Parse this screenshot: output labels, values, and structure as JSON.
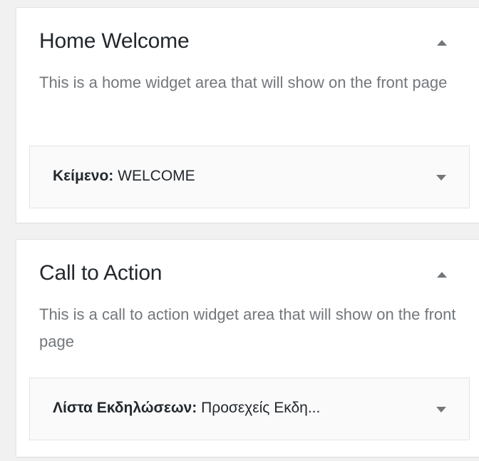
{
  "sidebars": [
    {
      "title": "Home Welcome",
      "description": "This is a home widget area that will show on the front page",
      "widget": {
        "name": "Κείμενο:",
        "title": "WELCOME"
      }
    },
    {
      "title": "Call to Action",
      "description": "This is a call to action widget area that will show on the front page",
      "widget": {
        "name": "Λίστα Εκδηλώσεων:",
        "title": "Προσεχείς Εκδη..."
      }
    }
  ],
  "icons": {
    "area_toggle": "triangle-up-icon",
    "widget_toggle": "triangle-down-icon"
  },
  "colors": {
    "background": "#f1f1f1",
    "panel": "#ffffff",
    "widget_bg": "#fafafa",
    "text": "#23282d",
    "muted": "#72777c"
  }
}
